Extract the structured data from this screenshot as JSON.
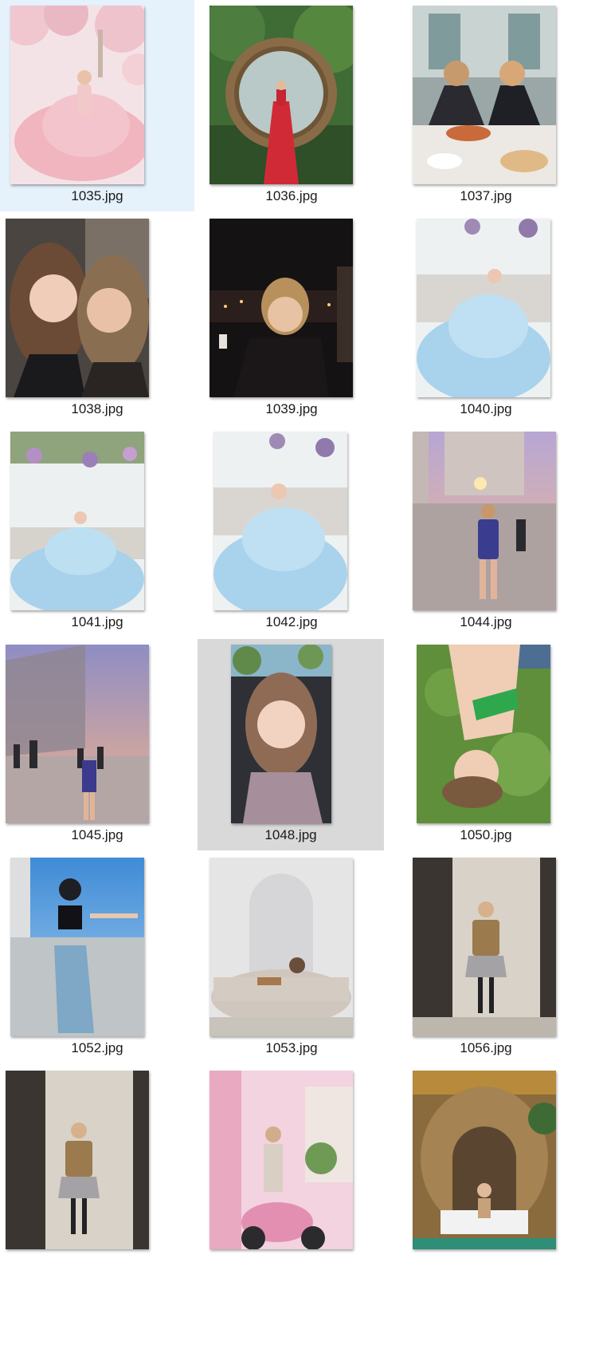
{
  "window": {
    "view": "large-icons"
  },
  "files": [
    {
      "name": "1035.jpg",
      "state": "selected",
      "scene": "pink-gown-blossoms"
    },
    {
      "name": "1036.jpg",
      "state": "normal",
      "scene": "red-dress-vine-arch"
    },
    {
      "name": "1037.jpg",
      "state": "normal",
      "scene": "two-women-dining"
    },
    {
      "name": "1038.jpg",
      "state": "normal",
      "scene": "two-women-selfie"
    },
    {
      "name": "1039.jpg",
      "state": "normal",
      "scene": "night-city-portrait"
    },
    {
      "name": "1040.jpg",
      "state": "normal",
      "scene": "blue-gown-studio"
    },
    {
      "name": "1041.jpg",
      "state": "normal",
      "scene": "blue-gown-wisteria"
    },
    {
      "name": "1042.jpg",
      "state": "normal",
      "scene": "blue-gown-closeup"
    },
    {
      "name": "1044.jpg",
      "state": "normal",
      "scene": "sunset-plaza-walk"
    },
    {
      "name": "1045.jpg",
      "state": "normal",
      "scene": "sunset-plaza-crowd"
    },
    {
      "name": "1048.jpg",
      "state": "hovered",
      "scene": "car-selfie"
    },
    {
      "name": "1050.jpg",
      "state": "normal",
      "scene": "lying-on-grass"
    },
    {
      "name": "1052.jpg",
      "state": "normal",
      "scene": "balcony-blue-sky"
    },
    {
      "name": "1053.jpg",
      "state": "normal",
      "scene": "stone-bathtub-arch"
    },
    {
      "name": "1056.jpg",
      "state": "normal",
      "scene": "stone-wall-coat"
    },
    {
      "name": "",
      "state": "normal",
      "scene": "stone-wall-coat-2"
    },
    {
      "name": "",
      "state": "normal",
      "scene": "pink-wall-scooter"
    },
    {
      "name": "",
      "state": "normal",
      "scene": "cave-bed"
    }
  ],
  "colors": {
    "selected_bg": "#e5f1fb",
    "hover_bg": "#d9d9d9",
    "caption_text": "#1a1a1a"
  }
}
